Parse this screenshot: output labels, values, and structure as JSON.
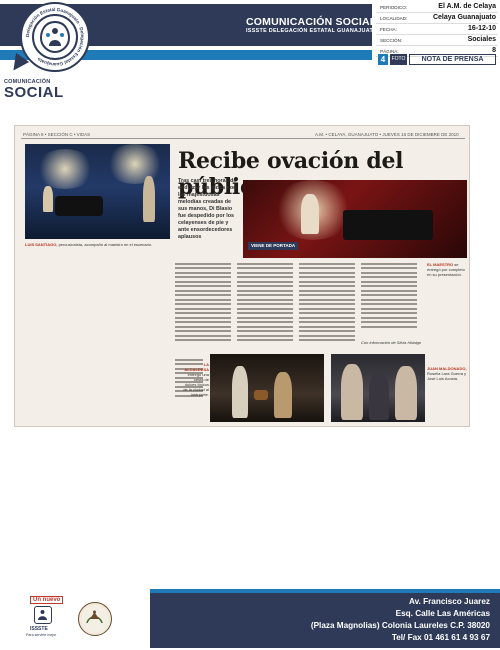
{
  "header": {
    "title": "COMUNICACIÓN SOCIAL",
    "subtitle": "ISSSTE DELEGACIÓN ESTATAL GUANAJUATO",
    "brand_small": "COMUNICACIÓN",
    "brand_big": "SOCIAL",
    "logo_ring_text": "Delegación Estatal Guanajuato · Delegación Estatal Guanajuato"
  },
  "meta": [
    {
      "label": "PERIODICO:",
      "value": "El A.M. de Celaya"
    },
    {
      "label": "LOCALIDAD:",
      "value": "Celaya Guanajuato"
    },
    {
      "label": "FECHA:",
      "value": "16-12-10"
    },
    {
      "label": "SECCIÓN:",
      "value": "Sociales"
    },
    {
      "label": "PÁGINA:",
      "value": "8"
    }
  ],
  "page_bar": {
    "number": "4",
    "foto": "FOTO",
    "nota": "NOTA DE PRENSA"
  },
  "clipping": {
    "page_head_left": "PÁGINA 8 • SECCIÓN C • VIDAS",
    "page_head_right": "A.M. • CELAYA, GUANAJUATO • JUEVES 16 DE DICIEMBRE DE 2010",
    "headline": "Recibe ovación del público",
    "lede": "Tras casi tres horas de endulzar los oídos con las majestuosas melodías creadas de sus manos, Di Blasio fue despedido por los celayenses de pie y ante ensordecedores aplausos",
    "caption_stage_name": "LUIS SANTIAGO,",
    "caption_stage": "percusionista, acompañó al maestro en el escenario.",
    "caption_concert_name": "EL MAESTRO",
    "caption_concert": "se entregó por completo en su presentación.",
    "viene": "VIENE DE PORTADA",
    "caption_mayor_name": "LA ALCALDESA",
    "caption_mayor": "entregó una cesta de dulces típicos de la ciudad al intérprete.",
    "caption_group_name": "JUAN MALDONADO,",
    "caption_group": "Roselia Lara Guerra y José Luis Acosta.",
    "byline": "Con información de Silvia Hidalgo"
  },
  "footer": {
    "un_nuevo": "Un nuevo",
    "issste": "ISSSTE",
    "slogan": "Para servirte mejor",
    "address_lines": [
      "Av. Francisco Juarez",
      "Esq. Calle Las Américas",
      "(Plaza Magnolias) Colonia Laureles C.P. 38020",
      "Tel/ Fax 01 461 61 4 93 67"
    ]
  },
  "colors": {
    "navy": "#2e3a57",
    "blue": "#1f7bb8",
    "accent_red": "#b8321e"
  }
}
